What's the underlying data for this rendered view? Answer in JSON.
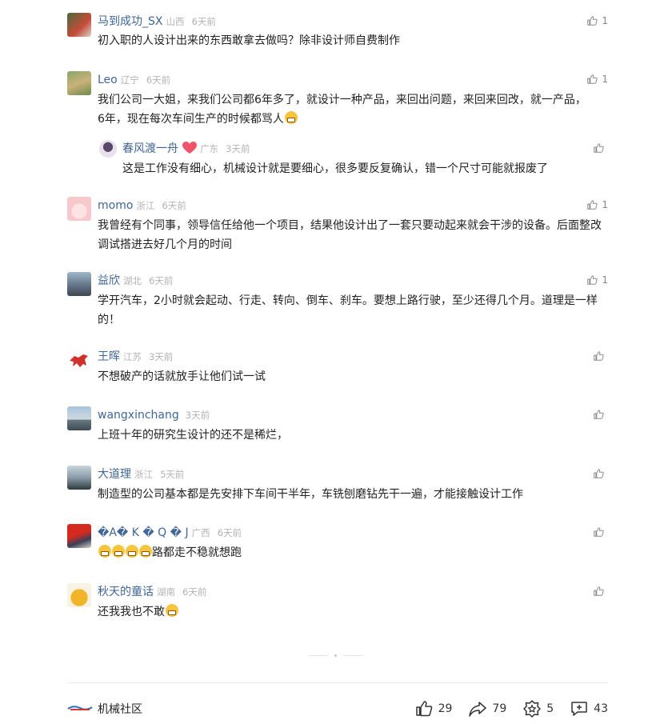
{
  "comments": [
    {
      "name": "马到成功_SX",
      "location": "山西",
      "time": "6天前",
      "likes": "1",
      "text": "初入职的人设计出来的东西敢拿去做吗？除非设计师自费制作"
    },
    {
      "name": "Leo",
      "location": "辽宁",
      "time": "6天前",
      "likes": "1",
      "text": "我们公司一大姐，来我们公司都6年多了，就设计一种产品，来回出问题，来回来回改，就一产品，6年，现在每次车间生产的时候都骂人",
      "reply": {
        "name": "春风渡一舟",
        "location": "广东",
        "time": "3天前",
        "likes": "",
        "text": "这是工作没有细心，机械设计就是要细心，很多要反复确认，错一个尺寸可能就报废了"
      }
    },
    {
      "name": "momo",
      "location": "浙江",
      "time": "6天前",
      "likes": "1",
      "text": "我曾经有个同事，领导信任给他一个项目，结果他设计出了一套只要动起来就会干涉的设备。后面整改调试搭进去好几个月的时间"
    },
    {
      "name": "益欣",
      "location": "湖北",
      "time": "6天前",
      "likes": "1",
      "text": "学开汽车，2小时就会起动、行走、转向、倒车、刹车。要想上路行驶，至少还得几个月。道理是一样的！"
    },
    {
      "name": "王晖",
      "location": "江苏",
      "time": "3天前",
      "likes": "",
      "text": "不想破产的话就放手让他们试一试"
    },
    {
      "name": "wangxinchang",
      "location": "",
      "time": "3天前",
      "likes": "",
      "text": "上班十年的研究生设计的还不是稀烂，"
    },
    {
      "name": "大道理",
      "location": "浙江",
      "time": "5天前",
      "likes": "",
      "text": "制造型的公司基本都是先安排下车间干半年，车铣刨磨钻先干一遍，才能接触设计工作"
    },
    {
      "name": "�A� K � Q � J",
      "location": "广西",
      "time": "6天前",
      "likes": "",
      "text": "路都走不稳就想跑"
    },
    {
      "name": "秋天的童话",
      "location": "湖南",
      "time": "6天前",
      "likes": "",
      "text": "还我我也不敢"
    }
  ],
  "footer": {
    "brand": "机械社区",
    "like_count": "29",
    "share_count": "79",
    "collect_count": "5",
    "comment_count": "43"
  },
  "colors": {
    "name": "#406599",
    "meta": "#b3b3b3",
    "text": "#222222"
  },
  "icons": [
    "thumb-up-icon",
    "share-icon",
    "collect-icon",
    "comment-icon",
    "heart-emoji-icon",
    "grin-emoji-icon"
  ]
}
